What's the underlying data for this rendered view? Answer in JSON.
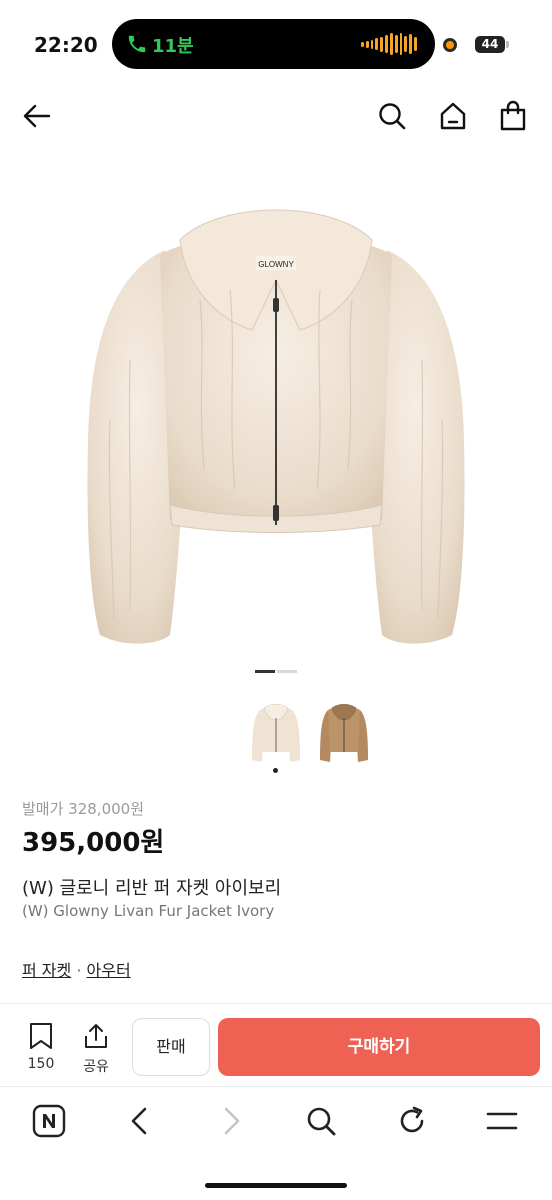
{
  "status_bar": {
    "time": "22:20",
    "call_label": "11분",
    "battery": "44"
  },
  "top_nav": {
    "back": "back-arrow-icon",
    "search": "search-icon",
    "home": "home-icon",
    "bag": "shopping-bag-icon"
  },
  "product": {
    "brand_tag": "GLOWNY",
    "release_price": "발매가 328,000원",
    "price": "395,000원",
    "title_ko": "(W) 글로니 리반 퍼 자켓 아이보리",
    "title_en": "(W) Glowny Livan Fur Jacket Ivory",
    "category_main": "퍼 자켓",
    "category_separator": "·",
    "category_sub": "아우터",
    "colors": {
      "ivory": "#efe3d3",
      "brown": "#b38a5f",
      "accent": "#ef6253"
    }
  },
  "action_bar": {
    "bookmark_count": "150",
    "share_label": "공유",
    "sell_label": "판매",
    "buy_label": "구매하기"
  },
  "browser_bar": {
    "icons": [
      "naver-n-icon",
      "back-chevron-icon",
      "forward-chevron-icon",
      "search-icon",
      "reload-icon",
      "menu-icon"
    ]
  }
}
